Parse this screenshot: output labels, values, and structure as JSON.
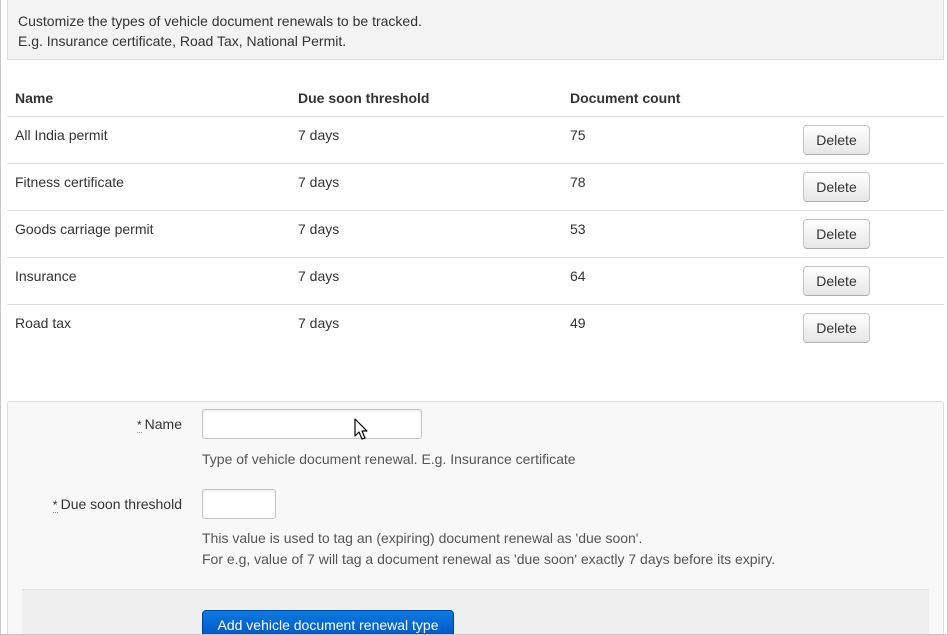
{
  "intro": {
    "line1": "Customize the types of vehicle document renewals to be tracked.",
    "line2": "E.g. Insurance certificate, Road Tax, National Permit."
  },
  "table": {
    "headers": [
      "Name",
      "Due soon threshold",
      "Document count",
      ""
    ],
    "rows": [
      {
        "name": "All India permit",
        "threshold": "7 days",
        "count": "75",
        "action": "Delete"
      },
      {
        "name": "Fitness certificate",
        "threshold": "7 days",
        "count": "78",
        "action": "Delete"
      },
      {
        "name": "Goods carriage permit",
        "threshold": "7 days",
        "count": "53",
        "action": "Delete"
      },
      {
        "name": "Insurance",
        "threshold": "7 days",
        "count": "64",
        "action": "Delete"
      },
      {
        "name": "Road tax",
        "threshold": "7 days",
        "count": "49",
        "action": "Delete"
      }
    ]
  },
  "form": {
    "required_mark": "*",
    "name_label": "Name",
    "name_value": "",
    "name_help": "Type of vehicle document renewal. E.g. Insurance certificate",
    "threshold_label": "Due soon threshold",
    "threshold_value": "",
    "threshold_help_1": "This value is used to tag an (expiring) document renewal as 'due soon'.",
    "threshold_help_2": "For e.g, value of 7 will tag a document renewal as 'due soon' exactly 7 days before its expiry.",
    "submit_label": "Add vehicle document renewal type"
  },
  "colors": {
    "primary": "#0066d6",
    "intro_bg": "#f3f3f3",
    "form_bg": "#f8f8f8"
  },
  "icons": {
    "cursor": "mouse-pointer-icon"
  }
}
